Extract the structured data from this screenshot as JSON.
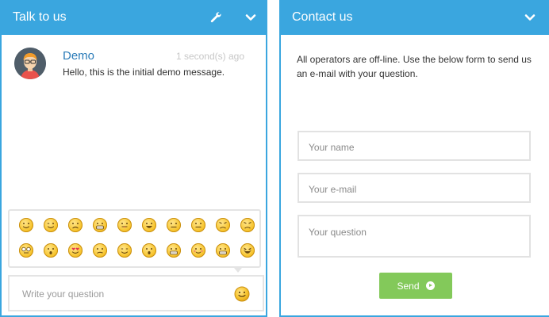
{
  "talk_panel": {
    "title": "Talk to us",
    "wrench_icon": "wrench-icon",
    "collapse_icon": "chevron-down-icon",
    "message": {
      "sender": "Demo",
      "time": "1 second(s) ago",
      "text": "Hello, this is the initial demo message."
    },
    "emojis": [
      "smile",
      "wink",
      "frown",
      "grin-teeth",
      "tongue",
      "big-smile",
      "neutral",
      "straight",
      "angry",
      "furious",
      "nerd",
      "shocked",
      "heart-eyes",
      "confused",
      "sly",
      "surprised",
      "laugh-teeth",
      "blush",
      "teeth-wide",
      "laughing"
    ],
    "input_placeholder": "Write your question",
    "smiley_button_icon": "smiley-icon"
  },
  "contact_panel": {
    "title": "Contact us",
    "collapse_icon": "chevron-down-icon",
    "info": "All operators are off-line. Use the below form to send us an e-mail with your question.",
    "name_placeholder": "Your name",
    "email_placeholder": "Your e-mail",
    "question_placeholder": "Your question",
    "send_label": "Send",
    "send_icon": "arrow-right-circle-icon"
  },
  "colors": {
    "header": "#3aa6df",
    "sender": "#2a7bb8",
    "send_button": "#83c95a"
  }
}
